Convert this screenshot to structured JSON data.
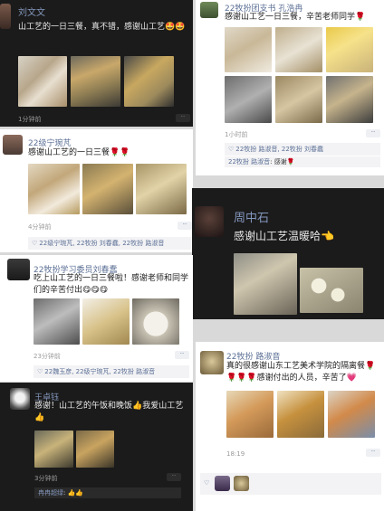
{
  "posts": {
    "p1": {
      "author": "刘文文",
      "text": "山工艺的一日三餐，真不错，感谢山工艺🤩🤩",
      "time": "1分钟前",
      "more": "··"
    },
    "p2": {
      "author": "22牧扮团支书 孔浩冉",
      "text": "感谢山工艺一日三餐，辛苦老师同学🌹",
      "time": "1小时前",
      "more": "··",
      "likes": "22牧扮 路淑音, 22牧扮 刘春蠢",
      "comment_name": "22牧扮 路淑音",
      "comment_text": ": 感谢🌹"
    },
    "p3": {
      "author": "22级宁琬芃",
      "text": "感谢山工艺的一日三餐🌹🌹",
      "time": "4分钟前",
      "more": "··",
      "likes": "22级宁琬芃, 22牧扮 刘春蠢, 22牧扮 路淑音"
    },
    "p4": {
      "author": "周中石",
      "text": "感谢山工艺温暖哈👈"
    },
    "p5": {
      "author": "22牧扮学习委员刘春蠢",
      "text": "吃上山工艺的一日三餐啦！感谢老师和同学们的辛苦付出😋😋😋",
      "time": "23分钟前",
      "more": "··",
      "likes": "22魏玉彦, 22级宁琬芃, 22牧扮 路淑音"
    },
    "p6": {
      "author": "22牧扮 路淑音",
      "text": "真的很感谢山东工艺美术学院的隔离餐🌹🌹🌹🌹感谢付出的人员，辛苦了💗",
      "time": "18:19",
      "more": "··"
    },
    "p7": {
      "author": "王卓钰",
      "text": "感谢！山工艺的午饭和晚饭👍我爱山工艺👍",
      "time": "3分钟前",
      "more": "··",
      "comment_name": "冉冉超绿",
      "comment_text": ": 👍👍"
    }
  },
  "colors": {
    "dark_bg": "#1b1b1b",
    "light_bg": "#ffffff",
    "name_blue": "#5b6f95"
  }
}
